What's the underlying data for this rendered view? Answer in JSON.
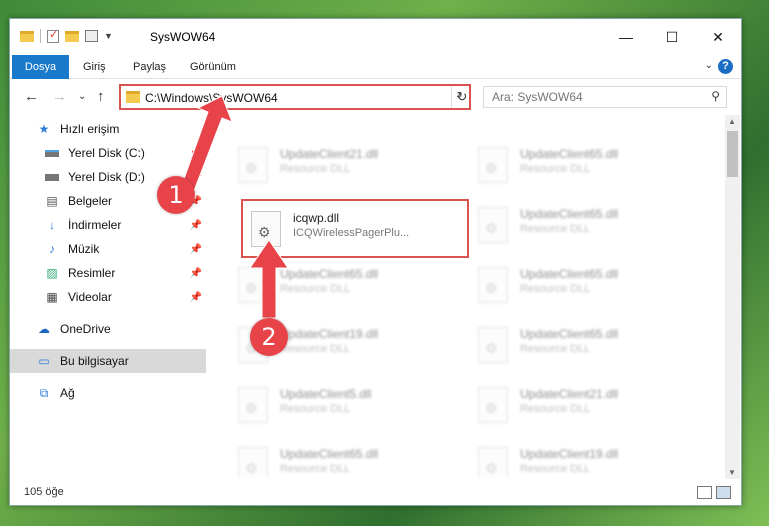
{
  "window": {
    "title": "SysWOW64",
    "controls": {
      "minimize": "—",
      "maximize": "☐",
      "close": "✕"
    }
  },
  "ribbon": {
    "tabs": [
      "Dosya",
      "Giriş",
      "Paylaş",
      "Görünüm"
    ],
    "help": "?"
  },
  "nav": {
    "address": "C:\\Windows\\SysWOW64",
    "search_placeholder": "Ara: SysWOW64"
  },
  "sidebar": {
    "items": [
      {
        "label": "Hızlı erişim",
        "icon": "star-icon",
        "pinned": false
      },
      {
        "label": "Yerel Disk (C:)",
        "icon": "drive-icon",
        "pinned": true
      },
      {
        "label": "Yerel Disk (D:)",
        "icon": "drive-icon",
        "pinned": true
      },
      {
        "label": "Belgeler",
        "icon": "documents-icon",
        "pinned": true
      },
      {
        "label": "İndirmeler",
        "icon": "download-icon",
        "pinned": true
      },
      {
        "label": "Müzik",
        "icon": "music-icon",
        "pinned": true
      },
      {
        "label": "Resimler",
        "icon": "pictures-icon",
        "pinned": true
      },
      {
        "label": "Videolar",
        "icon": "video-icon",
        "pinned": true
      },
      {
        "label": "OneDrive",
        "icon": "cloud-icon",
        "pinned": false
      },
      {
        "label": "Bu bilgisayar",
        "icon": "computer-icon",
        "pinned": false,
        "active": true
      },
      {
        "label": "Ağ",
        "icon": "network-icon",
        "pinned": false
      }
    ]
  },
  "files": [
    {
      "name": "UpdateClient21.dll",
      "type": "Resource DLL"
    },
    {
      "name": "UpdateClient65.dll",
      "type": "Resource DLL"
    },
    {
      "name": "icqwp.dll",
      "type": "ICQWirelessPagerPlu...",
      "highlighted": true
    },
    {
      "name": "UpdateClient65.dll",
      "type": "Resource DLL"
    },
    {
      "name": "UpdateClient65.dll",
      "type": "Resource DLL"
    },
    {
      "name": "UpdateClient65.dll",
      "type": "Resource DLL"
    },
    {
      "name": "UpdateClient19.dll",
      "type": "Resource DLL"
    },
    {
      "name": "UpdateClient65.dll",
      "type": "Resource DLL"
    },
    {
      "name": "UpdateClient5.dll",
      "type": "Resource DLL"
    },
    {
      "name": "UpdateClient21.dll",
      "type": "Resource DLL"
    },
    {
      "name": "UpdateClient65.dll",
      "type": "Resource DLL"
    },
    {
      "name": "UpdateClient19.dll",
      "type": "Resource DLL"
    }
  ],
  "status": {
    "count": "105 öğe"
  },
  "callouts": [
    "1",
    "2"
  ],
  "colors": {
    "accent": "#1979ca",
    "highlight": "#d9534f",
    "callout": "#e9434a"
  }
}
